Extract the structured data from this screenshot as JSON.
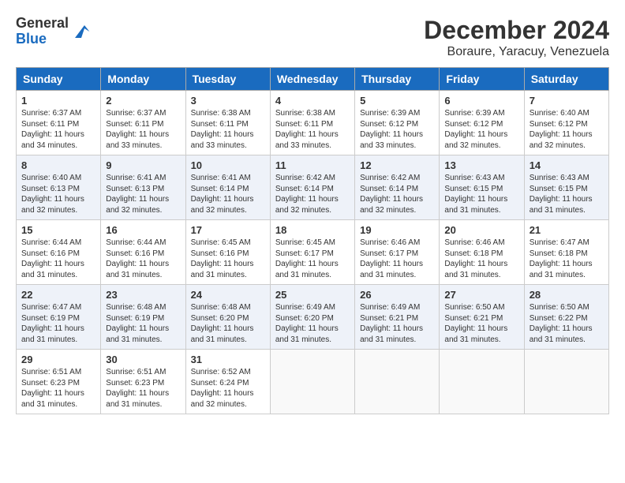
{
  "logo": {
    "general": "General",
    "blue": "Blue"
  },
  "header": {
    "month_year": "December 2024",
    "location": "Boraure, Yaracuy, Venezuela"
  },
  "weekdays": [
    "Sunday",
    "Monday",
    "Tuesday",
    "Wednesday",
    "Thursday",
    "Friday",
    "Saturday"
  ],
  "weeks": [
    [
      {
        "day": 1,
        "sunrise": "6:37 AM",
        "sunset": "6:11 PM",
        "daylight": "11 hours and 34 minutes."
      },
      {
        "day": 2,
        "sunrise": "6:37 AM",
        "sunset": "6:11 PM",
        "daylight": "11 hours and 33 minutes."
      },
      {
        "day": 3,
        "sunrise": "6:38 AM",
        "sunset": "6:11 PM",
        "daylight": "11 hours and 33 minutes."
      },
      {
        "day": 4,
        "sunrise": "6:38 AM",
        "sunset": "6:11 PM",
        "daylight": "11 hours and 33 minutes."
      },
      {
        "day": 5,
        "sunrise": "6:39 AM",
        "sunset": "6:12 PM",
        "daylight": "11 hours and 33 minutes."
      },
      {
        "day": 6,
        "sunrise": "6:39 AM",
        "sunset": "6:12 PM",
        "daylight": "11 hours and 32 minutes."
      },
      {
        "day": 7,
        "sunrise": "6:40 AM",
        "sunset": "6:12 PM",
        "daylight": "11 hours and 32 minutes."
      }
    ],
    [
      {
        "day": 8,
        "sunrise": "6:40 AM",
        "sunset": "6:13 PM",
        "daylight": "11 hours and 32 minutes."
      },
      {
        "day": 9,
        "sunrise": "6:41 AM",
        "sunset": "6:13 PM",
        "daylight": "11 hours and 32 minutes."
      },
      {
        "day": 10,
        "sunrise": "6:41 AM",
        "sunset": "6:14 PM",
        "daylight": "11 hours and 32 minutes."
      },
      {
        "day": 11,
        "sunrise": "6:42 AM",
        "sunset": "6:14 PM",
        "daylight": "11 hours and 32 minutes."
      },
      {
        "day": 12,
        "sunrise": "6:42 AM",
        "sunset": "6:14 PM",
        "daylight": "11 hours and 32 minutes."
      },
      {
        "day": 13,
        "sunrise": "6:43 AM",
        "sunset": "6:15 PM",
        "daylight": "11 hours and 31 minutes."
      },
      {
        "day": 14,
        "sunrise": "6:43 AM",
        "sunset": "6:15 PM",
        "daylight": "11 hours and 31 minutes."
      }
    ],
    [
      {
        "day": 15,
        "sunrise": "6:44 AM",
        "sunset": "6:16 PM",
        "daylight": "11 hours and 31 minutes."
      },
      {
        "day": 16,
        "sunrise": "6:44 AM",
        "sunset": "6:16 PM",
        "daylight": "11 hours and 31 minutes."
      },
      {
        "day": 17,
        "sunrise": "6:45 AM",
        "sunset": "6:16 PM",
        "daylight": "11 hours and 31 minutes."
      },
      {
        "day": 18,
        "sunrise": "6:45 AM",
        "sunset": "6:17 PM",
        "daylight": "11 hours and 31 minutes."
      },
      {
        "day": 19,
        "sunrise": "6:46 AM",
        "sunset": "6:17 PM",
        "daylight": "11 hours and 31 minutes."
      },
      {
        "day": 20,
        "sunrise": "6:46 AM",
        "sunset": "6:18 PM",
        "daylight": "11 hours and 31 minutes."
      },
      {
        "day": 21,
        "sunrise": "6:47 AM",
        "sunset": "6:18 PM",
        "daylight": "11 hours and 31 minutes."
      }
    ],
    [
      {
        "day": 22,
        "sunrise": "6:47 AM",
        "sunset": "6:19 PM",
        "daylight": "11 hours and 31 minutes."
      },
      {
        "day": 23,
        "sunrise": "6:48 AM",
        "sunset": "6:19 PM",
        "daylight": "11 hours and 31 minutes."
      },
      {
        "day": 24,
        "sunrise": "6:48 AM",
        "sunset": "6:20 PM",
        "daylight": "11 hours and 31 minutes."
      },
      {
        "day": 25,
        "sunrise": "6:49 AM",
        "sunset": "6:20 PM",
        "daylight": "11 hours and 31 minutes."
      },
      {
        "day": 26,
        "sunrise": "6:49 AM",
        "sunset": "6:21 PM",
        "daylight": "11 hours and 31 minutes."
      },
      {
        "day": 27,
        "sunrise": "6:50 AM",
        "sunset": "6:21 PM",
        "daylight": "11 hours and 31 minutes."
      },
      {
        "day": 28,
        "sunrise": "6:50 AM",
        "sunset": "6:22 PM",
        "daylight": "11 hours and 31 minutes."
      }
    ],
    [
      {
        "day": 29,
        "sunrise": "6:51 AM",
        "sunset": "6:23 PM",
        "daylight": "11 hours and 31 minutes."
      },
      {
        "day": 30,
        "sunrise": "6:51 AM",
        "sunset": "6:23 PM",
        "daylight": "11 hours and 31 minutes."
      },
      {
        "day": 31,
        "sunrise": "6:52 AM",
        "sunset": "6:24 PM",
        "daylight": "11 hours and 32 minutes."
      },
      null,
      null,
      null,
      null
    ]
  ]
}
